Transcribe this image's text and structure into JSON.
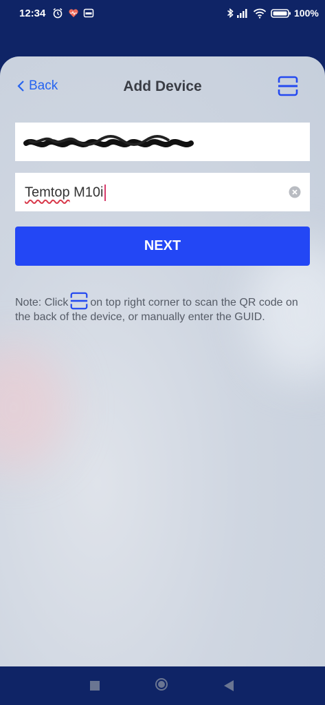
{
  "status_bar": {
    "time": "12:34",
    "battery": "100%",
    "icons": [
      "alarm-icon",
      "heart-rate-icon",
      "app-notification-icon",
      "bluetooth-icon",
      "signal-icon",
      "wifi-icon",
      "battery-icon"
    ]
  },
  "header": {
    "back_label": "Back",
    "title": "Add Device",
    "scan_icon": "scan-qr-icon"
  },
  "form": {
    "guid_value": "",
    "device_name": "Temtop M10i",
    "device_name_underlined": "Temtop",
    "device_name_rest": " M10i",
    "clear_icon": "clear-icon"
  },
  "next_button": {
    "label": "NEXT"
  },
  "note": {
    "prefix": "Note: Click",
    "suffix": "on top right corner to scan the QR code on the back of the device, or manually enter the GUID."
  },
  "colors": {
    "accent": "#2347f5",
    "link": "#2563f0",
    "top_bar": "#0f2466"
  }
}
